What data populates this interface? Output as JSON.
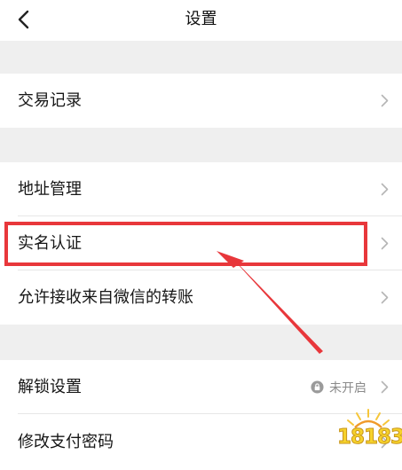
{
  "header": {
    "title": "设置",
    "back_icon": "chevron-left-icon"
  },
  "menu": {
    "items": [
      {
        "label": "交易记录"
      },
      {
        "label": "地址管理"
      },
      {
        "label": "实名认证"
      },
      {
        "label": "允许接收来自微信的转账"
      },
      {
        "label": "解锁设置",
        "status": "未开启",
        "status_icon": "lock-icon"
      },
      {
        "label": "修改支付密码"
      }
    ]
  },
  "annotation": {
    "highlight_color": "#e8373b",
    "arrow_color": "#e8373b",
    "target": "实名认证"
  },
  "watermark": {
    "text": "18183"
  },
  "colors": {
    "background": "#efefef",
    "row_background": "#ffffff",
    "text": "#161616",
    "secondary_text": "#8a8a8a",
    "chevron": "#b5b5b5"
  }
}
